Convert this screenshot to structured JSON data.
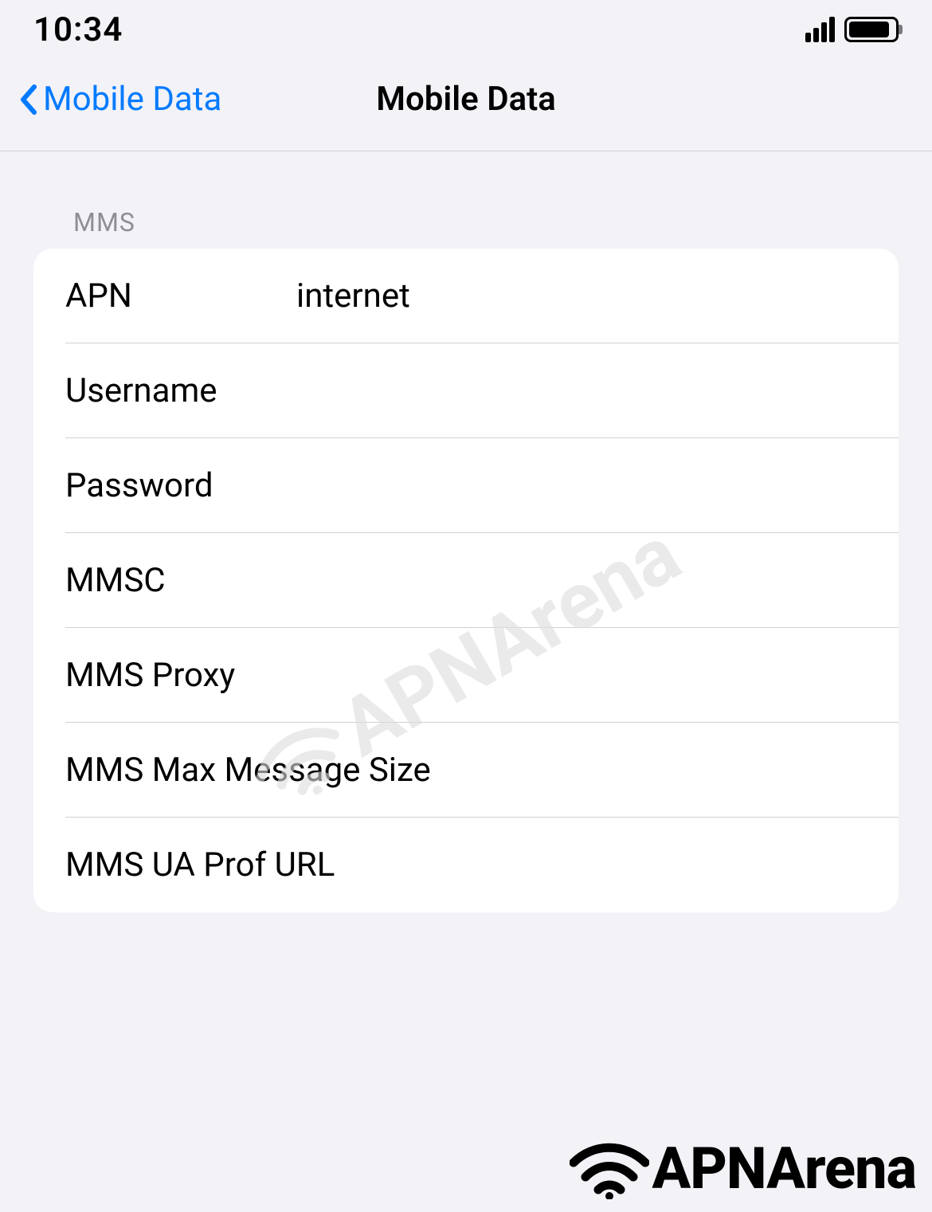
{
  "status": {
    "time": "10:34"
  },
  "nav": {
    "back_label": "Mobile Data",
    "title": "Mobile Data"
  },
  "section": {
    "header": "MMS"
  },
  "fields": {
    "apn": {
      "label": "APN",
      "value": "internet"
    },
    "username": {
      "label": "Username",
      "value": ""
    },
    "password": {
      "label": "Password",
      "value": ""
    },
    "mmsc": {
      "label": "MMSC",
      "value": ""
    },
    "mms_proxy": {
      "label": "MMS Proxy",
      "value": ""
    },
    "mms_max_size": {
      "label": "MMS Max Message Size",
      "value": ""
    },
    "mms_ua_prof": {
      "label": "MMS UA Prof URL",
      "value": ""
    }
  },
  "watermark": {
    "text": "APNArena"
  },
  "footer": {
    "brand": "APNArena"
  }
}
